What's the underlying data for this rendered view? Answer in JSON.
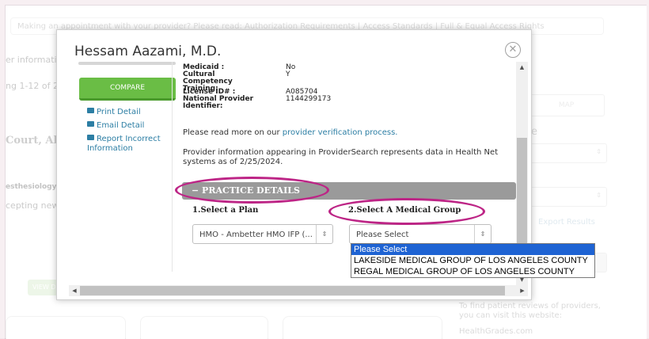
{
  "background": {
    "banner": "Making an appointment with your provider? Please read: Authorization Requirements | Access Standards | Full & Equal Access Rights",
    "info_label": "er informatio",
    "showing": "ng 1-12 of 21",
    "name_partial": "Court, Alise",
    "specialty_partial": "esthesiology",
    "accepting_partial": "cepting new p",
    "view_button": "VIEW D",
    "map_button": "MAP",
    "right_letter": "e",
    "export_results": "Export Results",
    "reviews_text": "To find patient reviews of providers, you can visit this website:",
    "healthgrades": "HealthGrades.com"
  },
  "modal": {
    "title": "Hessam Aazami, M.D.",
    "compare_label": "COMPARE",
    "actions": [
      {
        "label": "Print Detail",
        "icon": "print-icon"
      },
      {
        "label": "Email Detail",
        "icon": "email-icon"
      },
      {
        "label": "Report Incorrect Information",
        "icon": "report-icon"
      }
    ],
    "details": [
      {
        "label": "Medicaid :",
        "value": "No"
      },
      {
        "label": "Cultural Competency Training:",
        "value": "Y"
      },
      {
        "label": "License ID# :",
        "value": "A085704"
      },
      {
        "label": "National Provider Identifier:",
        "value": "1144299173"
      }
    ],
    "verify_text": "Please read more on our ",
    "verify_link": "provider verification process.",
    "data_note": "Provider information appearing in ProviderSearch represents data in Health Net systems as of 2/25/2024.",
    "section_title": "− PRACTICE DETAILS",
    "plan_label": "1.Select a Plan",
    "plan_value": "HMO - Ambetter HMO IFP (...",
    "group_label": "2.Select A Medical Group",
    "group_value": "Please Select"
  },
  "dropdown": {
    "options": [
      "Please Select",
      "LAKESIDE MEDICAL GROUP OF LOS ANGELES COUNTY",
      "REGAL MEDICAL GROUP OF LOS ANGELES COUNTY"
    ],
    "selected_index": 0
  },
  "colors": {
    "compare_green": "#6abd45",
    "link_blue": "#2c7ea4",
    "highlight_oval": "#bd2586",
    "dropdown_selected": "#1e63d3"
  }
}
